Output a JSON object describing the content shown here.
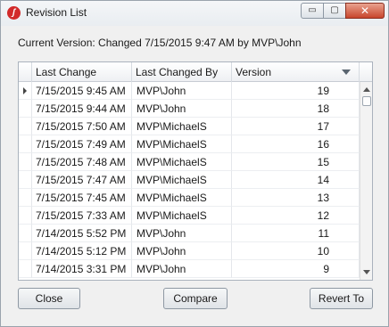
{
  "window": {
    "title": "Revision List",
    "app_icon": "app-logo-icon",
    "controls": {
      "minimize": "▭",
      "maximize": "▢",
      "close": "✕"
    }
  },
  "current_version": "Current Version: Changed 7/15/2015 9:47 AM by MVP\\John",
  "grid": {
    "columns": [
      "Last Change",
      "Last Changed By",
      "Version"
    ],
    "sort": {
      "column": "Version",
      "direction": "descending"
    },
    "rows": [
      {
        "last_change": "7/15/2015 9:45 AM",
        "changed_by": "MVP\\John",
        "version": "19",
        "selected": true
      },
      {
        "last_change": "7/15/2015 9:44 AM",
        "changed_by": "MVP\\John",
        "version": "18"
      },
      {
        "last_change": "7/15/2015 7:50 AM",
        "changed_by": "MVP\\MichaelS",
        "version": "17"
      },
      {
        "last_change": "7/15/2015 7:49 AM",
        "changed_by": "MVP\\MichaelS",
        "version": "16"
      },
      {
        "last_change": "7/15/2015 7:48 AM",
        "changed_by": "MVP\\MichaelS",
        "version": "15"
      },
      {
        "last_change": "7/15/2015 7:47 AM",
        "changed_by": "MVP\\MichaelS",
        "version": "14"
      },
      {
        "last_change": "7/15/2015 7:45 AM",
        "changed_by": "MVP\\MichaelS",
        "version": "13"
      },
      {
        "last_change": "7/15/2015 7:33 AM",
        "changed_by": "MVP\\MichaelS",
        "version": "12"
      },
      {
        "last_change": "7/14/2015 5:52 PM",
        "changed_by": "MVP\\John",
        "version": "11"
      },
      {
        "last_change": "7/14/2015 5:12 PM",
        "changed_by": "MVP\\John",
        "version": "10"
      },
      {
        "last_change": "7/14/2015 3:31 PM",
        "changed_by": "MVP\\John",
        "version": "9"
      }
    ]
  },
  "buttons": {
    "close": "Close",
    "compare": "Compare",
    "revert": "Revert To"
  },
  "colors": {
    "close_button": "#c8452c",
    "app_icon": "#d22a2a"
  }
}
